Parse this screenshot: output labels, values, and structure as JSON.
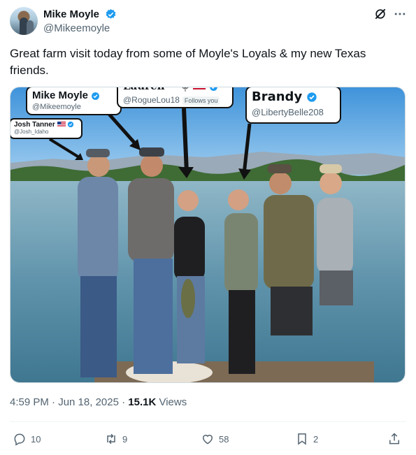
{
  "author": {
    "name": "Mike Moyle",
    "handle": "@Mikeemoyle"
  },
  "tweet": {
    "text": "Great farm visit today from some of Moyle's Loyals & my new Texas friends.",
    "timestamp": "4:59 PM · Jun 18, 2025",
    "separator": " · ",
    "views_count": "15.1K",
    "views_label": " Views"
  },
  "photo_tags": {
    "mike": {
      "name": "Mike Moyle",
      "handle": "@Mikeemoyle"
    },
    "lauren": {
      "name": "Lauren ~",
      "handle": "@RogueLou18",
      "follows": "Follows you"
    },
    "brandy": {
      "name": "Brandy",
      "handle": "@LibertyBelle208"
    },
    "josh": {
      "name": "Josh Tanner",
      "handle": "@Josh_Idaho"
    }
  },
  "actions": {
    "replies": "10",
    "reposts": "9",
    "likes": "58",
    "bookmarks": "2"
  },
  "colors": {
    "verified": "#1d9bf0",
    "text": "#0f1419",
    "secondary": "#536471"
  },
  "icons": [
    "verified-badge-icon",
    "grok-icon",
    "more-icon",
    "reply-icon",
    "repost-icon",
    "like-icon",
    "bookmark-icon",
    "share-icon",
    "us-flag-icon",
    "microphone-icon"
  ]
}
